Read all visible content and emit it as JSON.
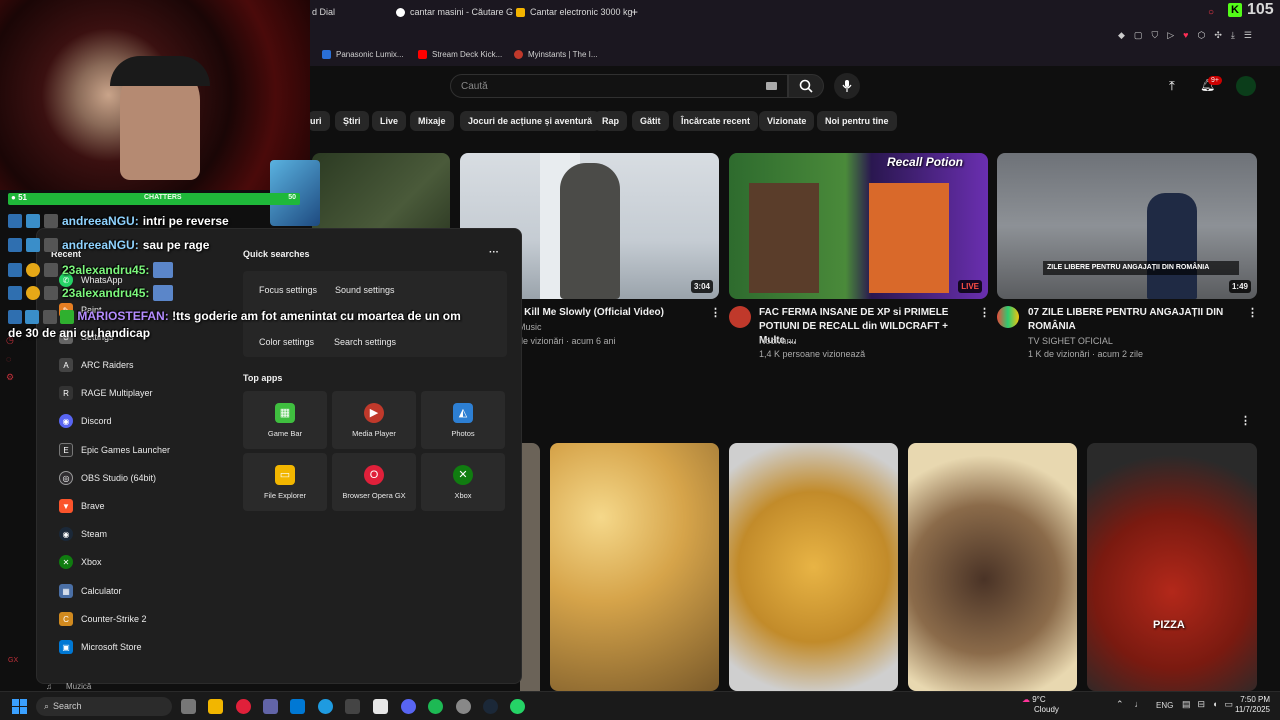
{
  "browser": {
    "tabs": [
      {
        "label": "d Dial",
        "color": "#444"
      },
      {
        "label": "cantar masini - Căutare G",
        "color": "#4285f4"
      },
      {
        "label": "Cantar electronic 3000 kg",
        "color": "#f4b400"
      }
    ],
    "new_tab": "+",
    "score": "105",
    "bookmarks": [
      {
        "label": "Panasonic Lumix...",
        "color": "#2a6fd6"
      },
      {
        "label": "Stream Deck Kick...",
        "color": "#ff0000"
      },
      {
        "label": "Myinstants | The I...",
        "color": "#c0392b"
      }
    ]
  },
  "youtube": {
    "search_placeholder": "Caută",
    "notifications": "9+",
    "chips": [
      "uri",
      "Știri",
      "Live",
      "Mixaje",
      "Jocuri de acțiune și aventură",
      "Rap",
      "Gătit",
      "Încărcate recent",
      "Vizionate",
      "Noi pentru tine"
    ],
    "videos": [
      {
        "title": "- Kill Me Slowly (Official Video)",
        "channel": "Music",
        "meta": "de vizionări · acum 6 ani",
        "duration": "3:04"
      },
      {
        "title": "FAC FERMA INSANE DE XP si PRIMELE POTIUNI DE RECALL din WILDCRAFT + Multe ...",
        "channel": "Nocivanu",
        "meta": "1,4 K persoane vizionează",
        "duration": "LIVE",
        "overlay": "Recall Potion"
      },
      {
        "title": "07  ZILE LIBERE PENTRU ANGAJAȚII DIN ROMÂNIA",
        "channel": "TV SIGHET OFICIAL",
        "meta": "1 K de vizionări · acum 2 zile",
        "duration": "1:49",
        "caption": "ZILE LIBERE PENTRU ANGAJAȚII DIN ROMÂNIA"
      }
    ],
    "shorts_caption": "PIZZA"
  },
  "start_menu": {
    "recent_label": "Recent",
    "quick_searches_label": "Quick searches",
    "more": "···",
    "quick_buttons": [
      "Focus settings",
      "Sound settings",
      "Color settings",
      "Search settings"
    ],
    "top_apps_label": "Top apps",
    "top_apps": [
      {
        "label": "Game Bar",
        "color": "#3fbf3f",
        "icon": "▦"
      },
      {
        "label": "Media Player",
        "color": "#c0392b",
        "icon": "▶"
      },
      {
        "label": "Photos",
        "color": "#2d7fd3",
        "icon": "◭"
      },
      {
        "label": "File Explorer",
        "color": "#f2b600",
        "icon": "▭"
      },
      {
        "label": "Browser Opera GX",
        "color": "#e0203a",
        "icon": "O"
      },
      {
        "label": "Xbox",
        "color": "#107c10",
        "icon": "✕"
      }
    ],
    "apps": [
      {
        "label": "WhatsApp",
        "color": "#25d366",
        "icon": "✆"
      },
      {
        "label": "Paint",
        "color": "#e67e22",
        "icon": "✎"
      },
      {
        "label": "Settings",
        "color": "#666",
        "icon": "⚙"
      },
      {
        "label": "ARC Raiders",
        "color": "#444",
        "icon": "A"
      },
      {
        "label": "RAGE Multiplayer",
        "color": "#333",
        "icon": "R"
      },
      {
        "label": "Discord",
        "color": "#5865f2",
        "icon": "◉"
      },
      {
        "label": "Epic Games Launcher",
        "color": "#2a2a2a",
        "icon": "E"
      },
      {
        "label": "OBS Studio (64bit)",
        "color": "#302e31",
        "icon": "◎"
      },
      {
        "label": "Brave",
        "color": "#fb542b",
        "icon": "▼"
      },
      {
        "label": "Steam",
        "color": "#1b2838",
        "icon": "◉"
      },
      {
        "label": "Xbox",
        "color": "#107c10",
        "icon": "✕"
      },
      {
        "label": "Calculator",
        "color": "#4a6fa5",
        "icon": "▦"
      },
      {
        "label": "Counter-Strike 2",
        "color": "#d18a1f",
        "icon": "C"
      },
      {
        "label": "Microsoft Store",
        "color": "#0078d4",
        "icon": "▣"
      }
    ],
    "bottom_item": "Muzică"
  },
  "stream_overlay": {
    "viewer_count": "51",
    "chatters_label": "CHATTERS",
    "chatters_count": "50",
    "chat": [
      {
        "user": "andreeaNGU:",
        "message": "intri pe reverse",
        "color": "#8fd3ff"
      },
      {
        "user": "andreeaNGU:",
        "message": "sau pe rage",
        "color": "#8fd3ff"
      },
      {
        "user": "23alexandru45:",
        "message": "",
        "color": "#7cf77c"
      },
      {
        "user": "23alexandru45:",
        "message": "",
        "color": "#7cf77c"
      },
      {
        "user": "MARIOSTEFAN:",
        "message": "!tts goderie am fot amenintat cu moartea de un om de 30 de ani cu handicap",
        "color": "#b48cff"
      }
    ]
  },
  "taskbar": {
    "search_placeholder": "Search",
    "weather_temp": "9°C",
    "weather_desc": "Cloudy",
    "language": "ENG",
    "time": "7:50 PM",
    "date": "11/7/2025"
  }
}
